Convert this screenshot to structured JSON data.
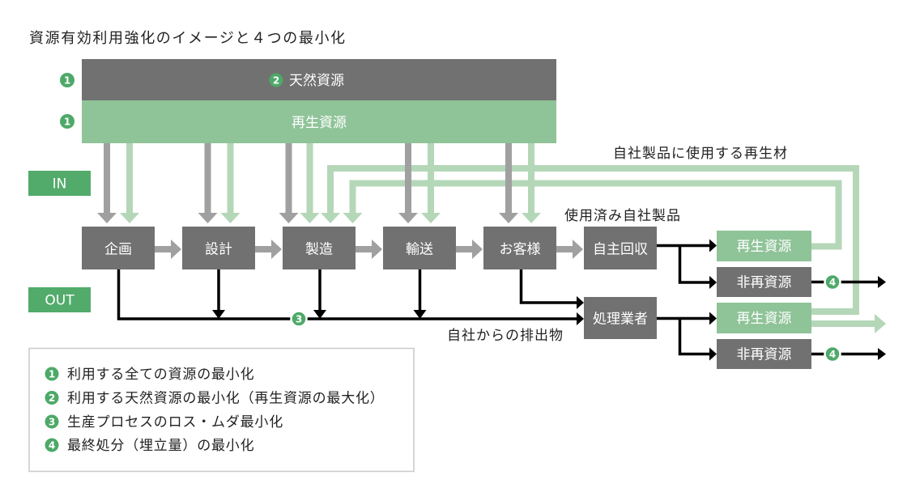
{
  "title": "資源有効利用強化のイメージと４つの最小化",
  "resource_bar": {
    "row_badges": [
      "1",
      "1"
    ],
    "natural": {
      "badge": "2",
      "label": "天然資源"
    },
    "recycled": {
      "label": "再生資源"
    }
  },
  "flow_labels": {
    "in": "IN",
    "out": "OUT"
  },
  "process_steps": [
    "企画",
    "設計",
    "製造",
    "輸送",
    "お客様",
    "自主回収"
  ],
  "disposal_contractor": "処理業者",
  "destinations": {
    "from_collection": [
      "再生資源",
      "非再資源"
    ],
    "from_contractor": [
      "再生資源",
      "非再資源"
    ]
  },
  "annotations": {
    "used_products": "使用済み自社製品",
    "recycled_material_loop": "自社製品に使用する再生材",
    "company_emissions": "自社からの排出物"
  },
  "markers": {
    "process_loss": "3",
    "final_disposal": "4"
  },
  "legend": [
    {
      "badge": "1",
      "text": "利用する全ての資源の最小化"
    },
    {
      "badge": "2",
      "text": "利用する天然資源の最小化（再生資源の最大化）"
    },
    {
      "badge": "3",
      "text": "生産プロセスのロス・ムダ最小化"
    },
    {
      "badge": "4",
      "text": "最終処分（埋立量）の最小化"
    }
  ],
  "colors": {
    "dark_box": "#717171",
    "gray_arrow": "#a0a0a0",
    "green_bar": "#8fc398",
    "light_green": "#b4d7b8",
    "label_green": "#52ab6b",
    "badge_green": "#4ea968"
  }
}
